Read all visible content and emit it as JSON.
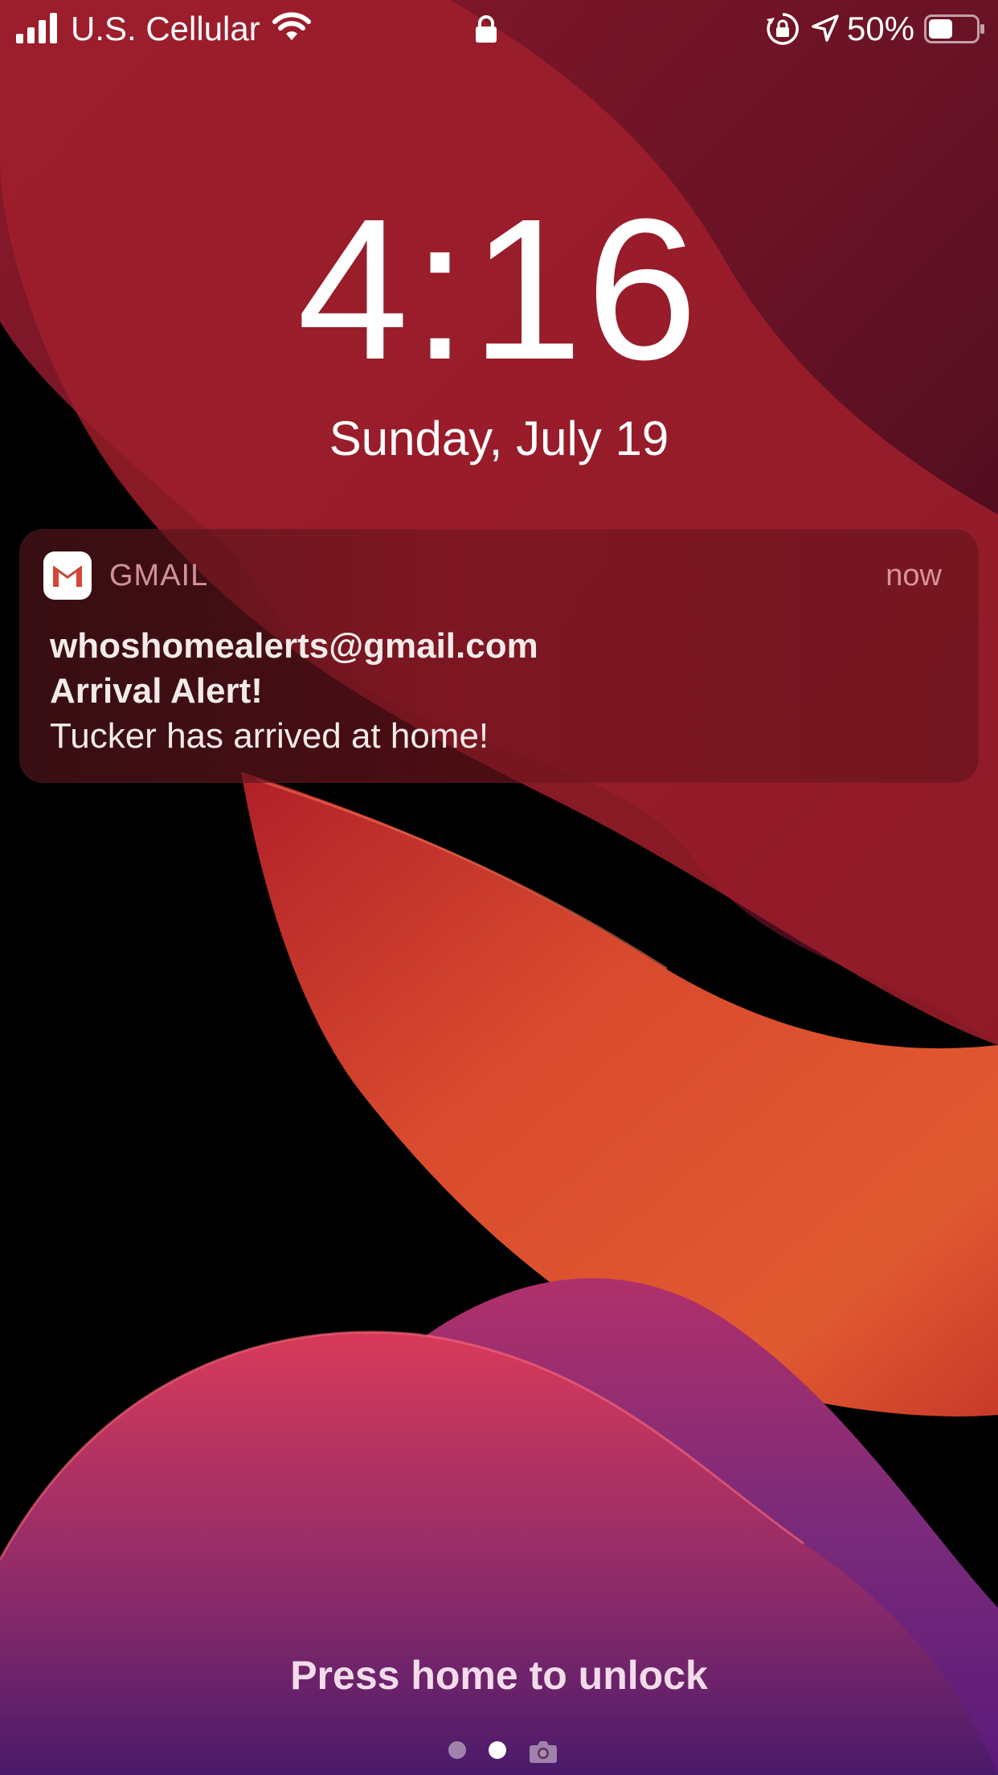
{
  "status_bar": {
    "carrier": "U.S. Cellular",
    "battery_percent": "50%",
    "battery_level": 0.5,
    "icons": [
      "signal-bars-icon",
      "wifi-icon",
      "lock-icon",
      "rotation-lock-icon",
      "location-arrow-icon",
      "battery-icon"
    ]
  },
  "lock_screen": {
    "time": "4:16",
    "date": "Sunday, July 19"
  },
  "notification": {
    "app_name": "GMAIL",
    "app_icon": "gmail-icon",
    "time": "now",
    "sender": "whoshomealerts@gmail.com",
    "title": "Arrival Alert!",
    "body": "Tucker has arrived at home!"
  },
  "bottom": {
    "unlock_hint": "Press home to unlock",
    "page_indicator": {
      "pages": 2,
      "current": 2,
      "camera_icon": "camera-icon"
    }
  },
  "colors": {
    "gmail_red": "#D44638",
    "notification_text": "#F3EAEA",
    "app_name_text": "#EBAAAF"
  }
}
